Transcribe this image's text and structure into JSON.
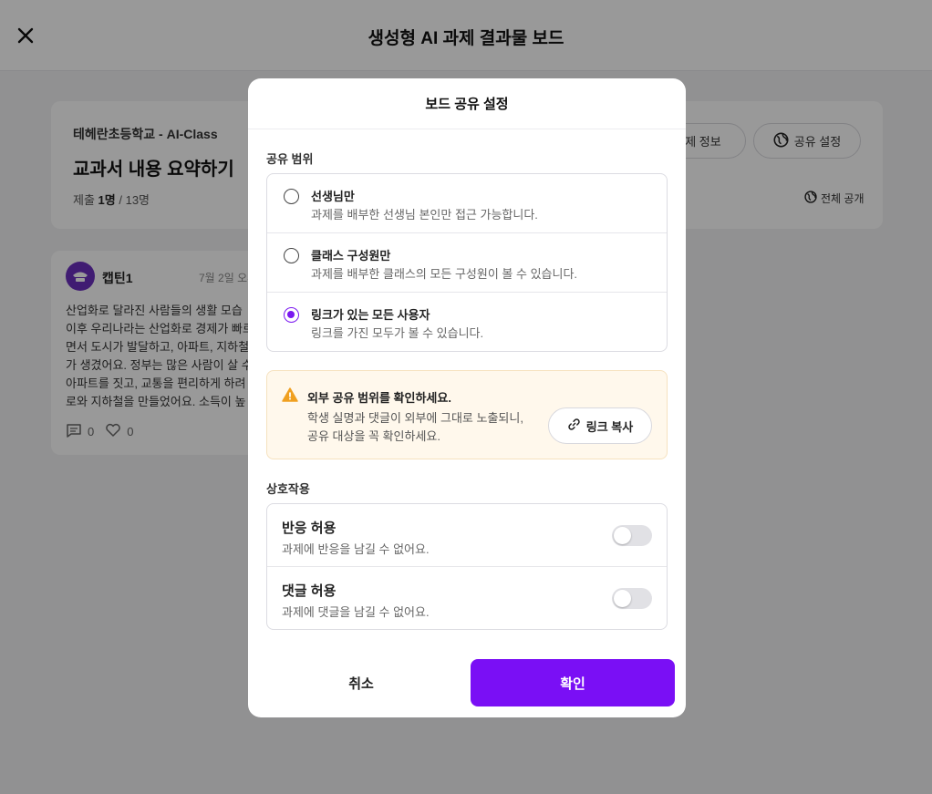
{
  "header": {
    "title": "생성형 AI 과제 결과물 보드"
  },
  "summary": {
    "school": "테헤란초등학교 - AI-Class",
    "assignment_title": "교과서 내용 요약하기",
    "submit_prefix": "제출 ",
    "submit_count": "1명",
    "submit_total": " / 13명",
    "info_button": "과제 정보",
    "share_button": "공유 설정",
    "visibility": "전체 공개"
  },
  "post": {
    "author": "캡틴1",
    "date": "7월 2일 오후",
    "body": "산업화로 달라진 사람들의 생활 모습\n이후 우리나라는 산업화로 경제가 빠르게\n면서 도시가 발달하고, 아파트, 지하철\n가 생겼어요. 정부는 많은 사람이 살 수\n아파트를 짓고, 교통을 편리하게 하려\n로와 지하철을 만들었어요. 소득이 높",
    "comments": "0",
    "likes": "0"
  },
  "modal": {
    "title": "보드 공유 설정",
    "scope_label": "공유 범위",
    "scope_options": [
      {
        "title": "선생님만",
        "desc": "과제를 배부한 선생님 본인만 접근 가능합니다.",
        "selected": false
      },
      {
        "title": "클래스 구성원만",
        "desc": "과제를 배부한 클래스의 모든 구성원이 볼 수 있습니다.",
        "selected": false
      },
      {
        "title": "링크가 있는 모든 사용자",
        "desc": "링크를 가진 모두가 볼 수 있습니다.",
        "selected": true
      }
    ],
    "warning": {
      "title": "외부 공유 범위를 확인하세요.",
      "line1": "학생 실명과 댓글이 외부에 그대로 노출되니,",
      "line2": "공유 대상을 꼭 확인하세요.",
      "copy_button": "링크 복사"
    },
    "interaction_label": "상호작용",
    "toggles": [
      {
        "title": "반응 허용",
        "desc": "과제에 반응을 남길 수 없어요.",
        "on": false
      },
      {
        "title": "댓글 허용",
        "desc": "과제에 댓글을 남길 수 없어요.",
        "on": false
      }
    ],
    "cancel": "취소",
    "confirm": "확인"
  },
  "colors": {
    "accent": "#7a0ff5",
    "warning_bg": "#fff8ec",
    "warning_icon": "#f0a020",
    "avatar": "#6b2fbf"
  }
}
